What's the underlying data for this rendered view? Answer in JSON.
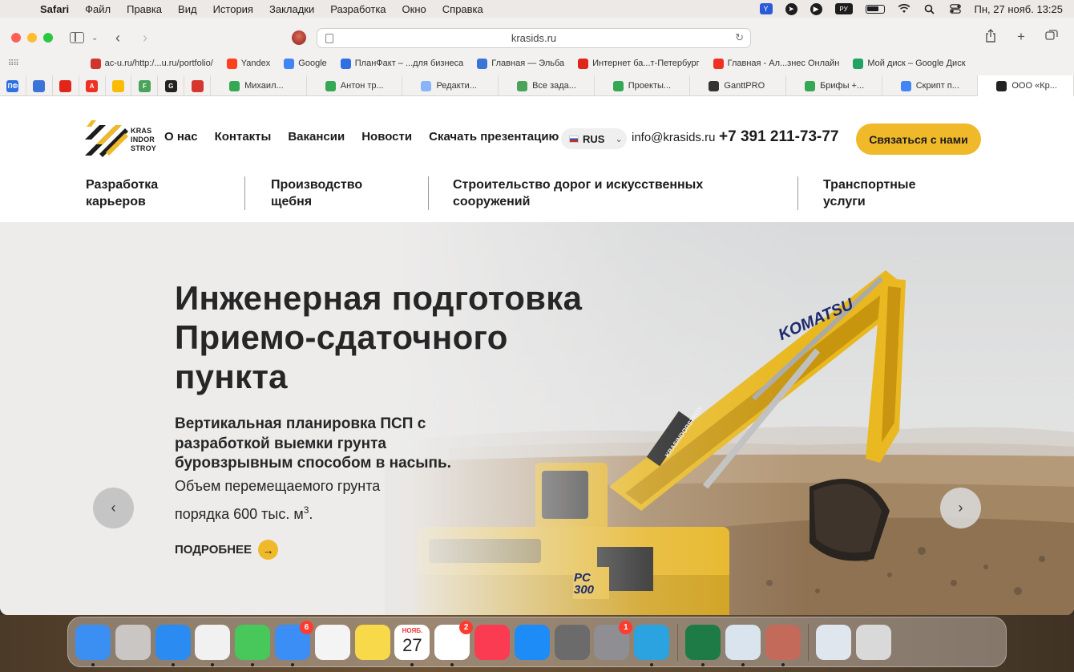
{
  "menubar": {
    "app": "Safari",
    "items": [
      "Файл",
      "Правка",
      "Вид",
      "История",
      "Закладки",
      "Разработка",
      "Окно",
      "Справка"
    ],
    "keyboard_layout": "РУ",
    "datetime": "Пн, 27 нояб.  13:25"
  },
  "browser": {
    "url": "krasids.ru",
    "bookmarks": [
      {
        "label": "ac-u.ru/http:/...u.ru/portfolio/",
        "color": "#d0342c",
        "icon": "ac-u-icon"
      },
      {
        "label": "Yandex",
        "color": "#fc3f1d",
        "icon": "yandex-icon"
      },
      {
        "label": "Google",
        "color": "#4285f4",
        "icon": "google-icon"
      },
      {
        "label": "ПланФакт – ...для бизнеса",
        "color": "#2f6fe4",
        "icon": "planfact-icon"
      },
      {
        "label": "Главная — Эльба",
        "color": "#3a74d9",
        "icon": "elba-icon"
      },
      {
        "label": "Интернет ба...т-Петербург",
        "color": "#e0251b",
        "icon": "bank-icon"
      },
      {
        "label": "Главная - Ал...знес Онлайн",
        "color": "#ef3124",
        "icon": "alfa-icon"
      },
      {
        "label": "Мой диск – Google Диск",
        "color": "#1fa463",
        "icon": "google-drive-icon"
      }
    ],
    "pinned_tabs": [
      {
        "label": "ПФ",
        "color": "#2f6fe4"
      },
      {
        "label": "",
        "color": "#3a74d9"
      },
      {
        "label": "",
        "color": "#e0251b"
      },
      {
        "label": "A",
        "color": "#ef3124"
      },
      {
        "label": "",
        "color": "#fbbc04"
      },
      {
        "label": "F",
        "color": "#49a35b"
      },
      {
        "label": "G",
        "color": "#222222"
      },
      {
        "label": "",
        "color": "#d6362f"
      }
    ],
    "tabs": [
      {
        "label": "Михаил...",
        "color": "#34a853"
      },
      {
        "label": "Антон тр...",
        "color": "#34a853"
      },
      {
        "label": "Редакти...",
        "color": "#8ab4f8"
      },
      {
        "label": "Все зада...",
        "color": "#49a35b"
      },
      {
        "label": "Проекты...",
        "color": "#34a853"
      },
      {
        "label": "GanttPRO",
        "color": "#333333"
      },
      {
        "label": "Брифы +...",
        "color": "#34a853"
      },
      {
        "label": "Скрипт п...",
        "color": "#4285f4"
      },
      {
        "label": "ООО «Кр...",
        "color": "#222222",
        "active": true
      }
    ]
  },
  "site": {
    "logo_text": [
      "KRAS",
      "INDOR",
      "STROY"
    ],
    "nav": [
      "О нас",
      "Контакты",
      "Вакансии",
      "Новости",
      "Скачать презентацию"
    ],
    "lang": "RUS",
    "email": "info@krasids.ru",
    "phone": "+7 391 211-73-77",
    "cta": "Связаться с нами",
    "services": [
      {
        "line1": "Разработка",
        "line2": "карьеров"
      },
      {
        "line1": "Производство",
        "line2": "щебня"
      },
      {
        "line1": "Строительство дорог и искусственных",
        "line2": "сооружений"
      },
      {
        "line1": "Транспортные",
        "line2": "услуги"
      }
    ],
    "hero": {
      "title_lines": [
        "Инженерная подготовка",
        "Приемо-сдаточного",
        "пункта"
      ],
      "subtitle_lines": [
        "Вертикальная планировка ПСП с",
        "разработкой выемки грунта",
        "буровзрывным способом в насыпь."
      ],
      "text_line1": "Объем перемещаемого грунта",
      "text_line2": "порядка 600 тыс. м",
      "text_sup": "3",
      "text_end": ".",
      "more": "ПОДРОБНЕЕ",
      "excavator_brand": "KOMATSU",
      "excavator_model": "PC 300",
      "excavator_arm_text": "KRASINDORSTROY",
      "prev": "‹",
      "next": "›"
    },
    "accent_color": "#f0b92a"
  },
  "dock": {
    "apps": [
      {
        "name": "finder-icon",
        "color": "#3c8ff2",
        "badge": ""
      },
      {
        "name": "launchpad-icon",
        "color": "#c9c6c4",
        "badge": ""
      },
      {
        "name": "safari-icon",
        "color": "#2a8cf2",
        "badge": ""
      },
      {
        "name": "chrome-icon",
        "color": "#f1f1f1",
        "badge": ""
      },
      {
        "name": "messages-icon",
        "color": "#48c75a",
        "badge": ""
      },
      {
        "name": "mail-icon",
        "color": "#3a8ef5",
        "badge": "6"
      },
      {
        "name": "photos-icon",
        "color": "#f4f4f4",
        "badge": ""
      },
      {
        "name": "notes-icon",
        "color": "#f8d949",
        "badge": ""
      },
      {
        "name": "calendar-icon",
        "color": "#ffffff",
        "badge": "",
        "month": "НОЯБ.",
        "day": "27"
      },
      {
        "name": "reminders-icon",
        "color": "#ffffff",
        "badge": "2"
      },
      {
        "name": "music-icon",
        "color": "#fa3b52",
        "badge": ""
      },
      {
        "name": "app-store-icon",
        "color": "#1e8cf7",
        "badge": ""
      },
      {
        "name": "calculator-icon",
        "color": "#6b6b6b",
        "badge": ""
      },
      {
        "name": "system-settings-icon",
        "color": "#8e8e93",
        "badge": "1"
      },
      {
        "name": "telegram-icon",
        "color": "#2aa3e0",
        "badge": ""
      }
    ],
    "apps_right": [
      {
        "name": "excel-icon",
        "color": "#1e7b45",
        "badge": ""
      },
      {
        "name": "preview-icon",
        "color": "#d9e4ee",
        "badge": ""
      },
      {
        "name": "certificate-icon",
        "color": "#c46a5a",
        "badge": ""
      }
    ],
    "apps_far": [
      {
        "name": "downloads-stack-icon",
        "color": "#dfe6ee",
        "badge": ""
      },
      {
        "name": "trash-icon",
        "color": "#d9d9d9",
        "badge": ""
      }
    ]
  }
}
